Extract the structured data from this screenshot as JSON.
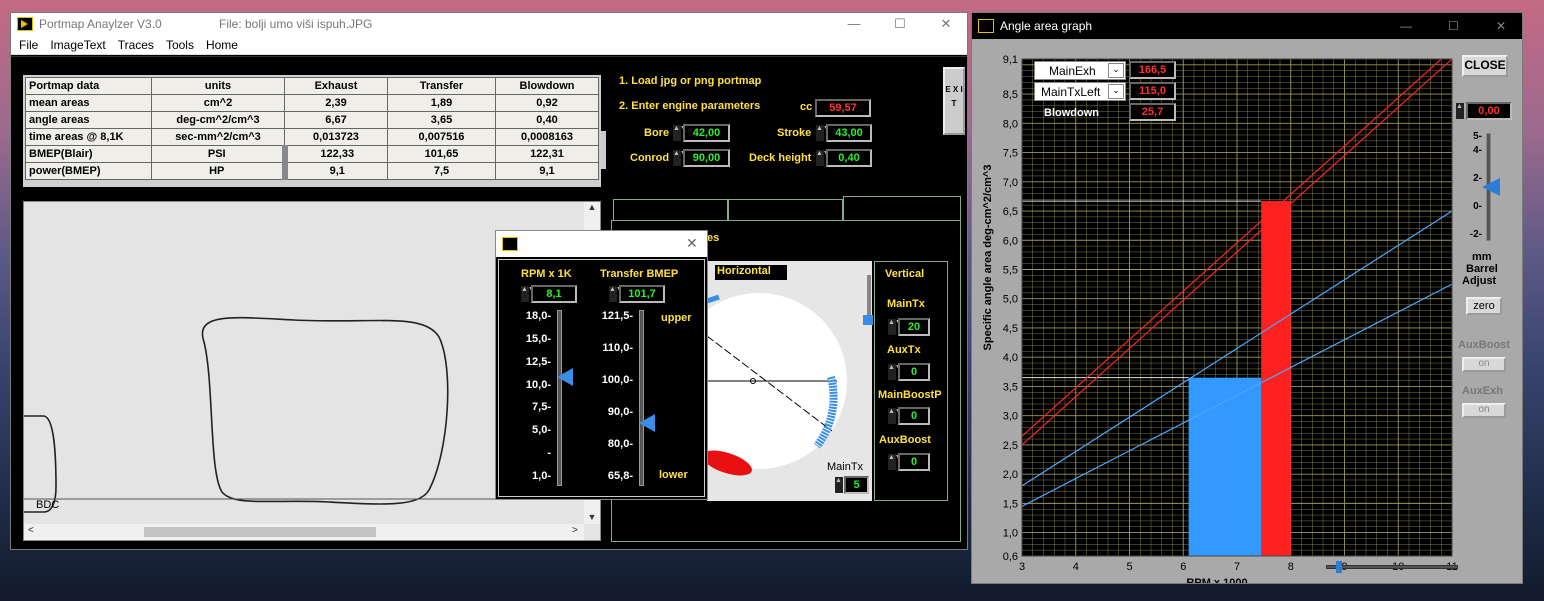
{
  "main_window": {
    "title": "Portmap Anaylzer V3.0",
    "file": "File: bolji umo viši ispuh.JPG",
    "minimize": "—",
    "maximize": "☐",
    "close": "✕"
  },
  "menu": [
    "File",
    "ImageText",
    "Traces",
    "Tools",
    "Home"
  ],
  "table": {
    "headers": [
      "Portmap data",
      "units",
      "Exhaust",
      "Transfer",
      "Blowdown"
    ],
    "rows": [
      [
        "mean areas",
        "cm^2",
        "2,39",
        "1,89",
        "0,92"
      ],
      [
        "angle areas",
        "deg-cm^2/cm^3",
        "6,67",
        "3,65",
        "0,40"
      ],
      [
        "time areas @ 8,1K",
        "sec-mm^2/cm^3",
        "0,013723",
        "0,007516",
        "0,0008163"
      ],
      [
        "BMEP(Blair)",
        "PSI",
        "122,33",
        "101,65",
        "122,31"
      ],
      [
        "power(BMEP)",
        "HP",
        "9,1",
        "7,5",
        "9,1"
      ]
    ]
  },
  "steps": {
    "s1": "1. Load jpg or png portmap",
    "s2": "2. Enter engine parameters"
  },
  "params": {
    "cc_label": "cc",
    "cc": "59,57",
    "bore_label": "Bore",
    "bore": "42,00",
    "stroke_label": "Stroke",
    "stroke": "43,00",
    "conrod_label": "Conrod",
    "conrod": "90,00",
    "deck_label": "Deck height",
    "deck": "0,40"
  },
  "exit_label": "E X I T",
  "bdc_label": "BDC",
  "partial_label": "les",
  "horizontal_label": "Horizontal",
  "vertical": {
    "title": "Vertical",
    "main_tx_label": "MainTx",
    "main_tx": "20",
    "aux_tx_label": "AuxTx",
    "aux_tx": "0",
    "main_boost_label": "MainBoostP",
    "main_boost": "0",
    "aux_boost_label": "AuxBoost",
    "aux_boost": "0"
  },
  "maintx_small": {
    "label": "MainTx",
    "value": "5"
  },
  "popup": {
    "close": "✕",
    "rpm_label": "RPM x 1K",
    "rpm": "8,1",
    "bmep_label": "Transfer BMEP",
    "bmep": "101,7",
    "upper": "upper",
    "lower": "lower",
    "rpm_ticks": [
      "18,0-",
      "15,0-",
      "12,5-",
      "10,0-",
      "7,5-",
      "5,0-",
      "-",
      "1,0-"
    ],
    "bmep_ticks": [
      "121,5-",
      "110,0-",
      "100,0-",
      "90,0-",
      "80,0-",
      "65,8-"
    ],
    "rpm_slider_fraction": 0.38,
    "bmep_slider_fraction": 0.64
  },
  "graph_window": {
    "title": "Angle area graph",
    "minimize": "—",
    "maximize": "☐",
    "close": "✕",
    "close_button": "CLOSE",
    "legend": [
      {
        "name": "MainExh",
        "value": "166,5"
      },
      {
        "name": "MainTxLeft",
        "value": "115,0"
      },
      {
        "name": "Blowdown",
        "value": "25,7"
      }
    ],
    "barrel": {
      "value": "0,00",
      "ticks": [
        "5-",
        "4-",
        "2-",
        "0-",
        "-2-"
      ],
      "label1": "mm",
      "label2": "Barrel",
      "label3": "Adjust",
      "zero": "zero",
      "fraction": 0.5
    },
    "aux_boost": {
      "label": "AuxBoost",
      "btn": "on"
    },
    "aux_exh": {
      "label": "AuxExh",
      "btn": "on"
    },
    "colors": {
      "exh": "#ff2020",
      "tx": "#3399ff",
      "blowdown": "#33ee33",
      "grid": "#9a9a5a"
    }
  },
  "chart_data": {
    "type": "bar",
    "xlabel": "RPM x 1000",
    "ylabel": "Specific angle area deg-cm^2/cm^3",
    "xlim": [
      3,
      11
    ],
    "ylim": [
      0.6,
      9.1
    ],
    "x_ticks": [
      "3",
      "4",
      "5",
      "6",
      "7",
      "8",
      "9",
      "10",
      "11"
    ],
    "y_ticks": [
      "0,6",
      "1,0",
      "1,5",
      "2,0",
      "2,5",
      "3,0",
      "3,5",
      "4,0",
      "4,5",
      "5,0",
      "5,5",
      "6,0",
      "6,5",
      "7,0",
      "7,5",
      "8,0",
      "8,5",
      "9,1"
    ],
    "bars": [
      {
        "series": "transfer",
        "x0": 6.1,
        "x1": 7.45,
        "y": 3.65,
        "color": "#3399ff"
      },
      {
        "series": "blowdown",
        "x0": 7.45,
        "x1": 7.65,
        "y": 3.65,
        "color": "#33ee33"
      },
      {
        "series": "exhaust",
        "x0": 7.45,
        "x1": 8.0,
        "y": 6.67,
        "color": "#ff2020"
      }
    ],
    "lines": [
      {
        "series": "exhaust-upper",
        "p0": [
          3,
          2.65
        ],
        "p1": [
          10.8,
          9.1
        ],
        "color": "#ff2020"
      },
      {
        "series": "exhaust-lower",
        "p0": [
          3,
          2.5
        ],
        "p1": [
          11,
          9.1
        ],
        "color": "#ff2020"
      },
      {
        "series": "transfer-upper",
        "p0": [
          3,
          1.8
        ],
        "p1": [
          11,
          6.5
        ],
        "color": "#4aa8ff"
      },
      {
        "series": "transfer-lower",
        "p0": [
          3,
          1.45
        ],
        "p1": [
          11,
          5.25
        ],
        "color": "#4aa8ff"
      }
    ],
    "hlines": [
      {
        "y": 6.67,
        "x1": 7.45
      },
      {
        "y": 3.65,
        "x1": 6.1
      }
    ],
    "grid": true
  }
}
